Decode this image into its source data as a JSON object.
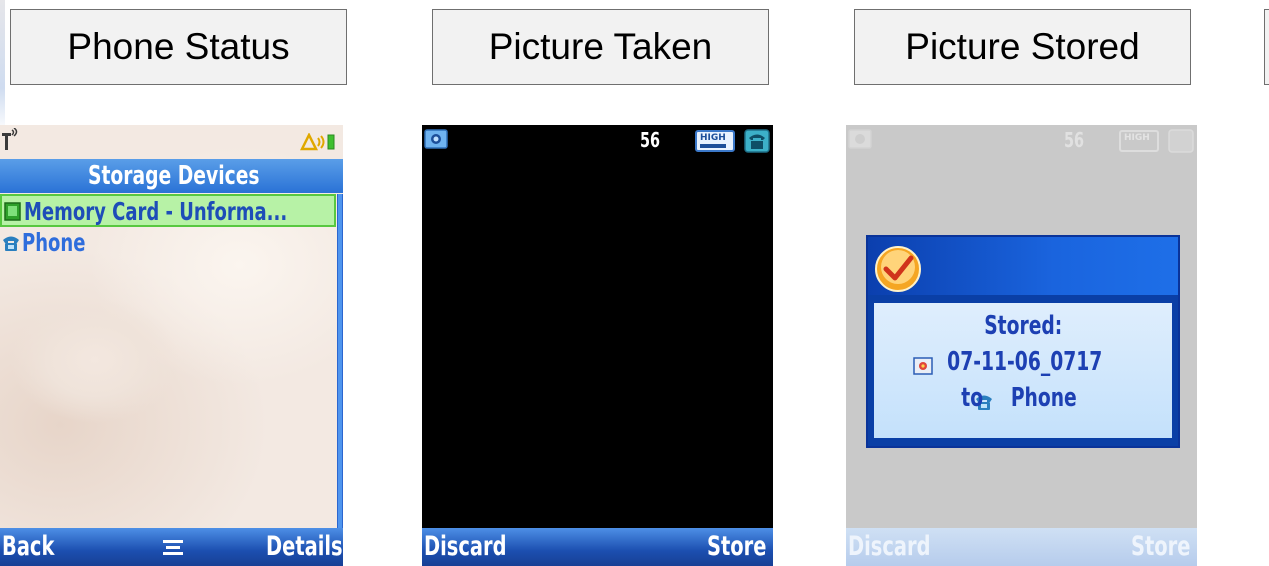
{
  "titles": {
    "phone_status": "Phone Status",
    "picture_taken": "Picture Taken",
    "picture_stored": "Picture Stored"
  },
  "screen1": {
    "header": "Storage Devices",
    "items": [
      {
        "label": "Memory Card - Unforma...",
        "icon": "memory-card-icon",
        "selected": true
      },
      {
        "label": "Phone",
        "icon": "phone-icon",
        "selected": false
      }
    ],
    "softkeys": {
      "left": "Back",
      "center_icon": "menu-icon",
      "right": "Details"
    }
  },
  "screen2": {
    "status_counter": "56",
    "quality": "HIGH",
    "softkeys": {
      "left": "Discard",
      "right": "Store"
    }
  },
  "screen3": {
    "status_counter": "56",
    "quality": "HIGH",
    "dialog": {
      "line1": "Stored:",
      "filename": "07-11-06_0717",
      "line3_prefix": "to",
      "destination": "Phone"
    },
    "softkeys": {
      "left": "Discard",
      "right": "Store"
    }
  },
  "colors": {
    "header_blue": "#2a72d6",
    "selection_green": "#b7f2a6",
    "dialog_blue": "#0a3fa6",
    "text_blue": "#1e4db8"
  }
}
